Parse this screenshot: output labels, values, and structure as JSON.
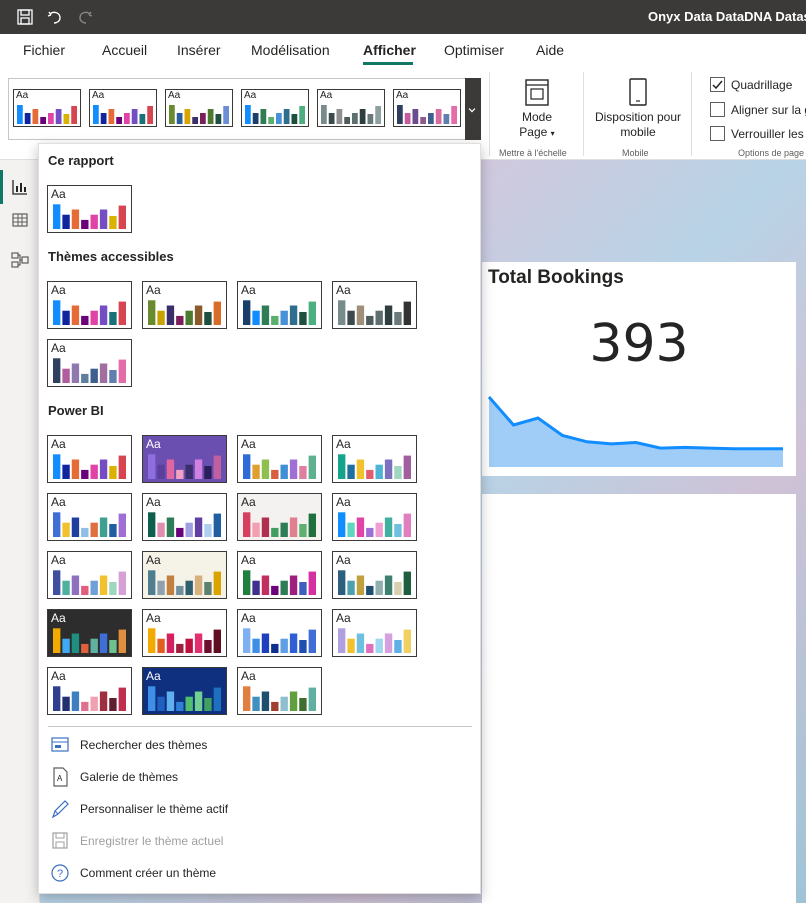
{
  "window": {
    "title": "Onyx Data DataDNA Dataset ("
  },
  "menu": {
    "items": [
      {
        "label": "Fichier",
        "active": false
      },
      {
        "label": "Accueil",
        "active": false
      },
      {
        "label": "Insérer",
        "active": false
      },
      {
        "label": "Modélisation",
        "active": false
      },
      {
        "label": "Afficher",
        "active": true
      },
      {
        "label": "Optimiser",
        "active": false
      },
      {
        "label": "Aide",
        "active": false
      }
    ]
  },
  "ribbon": {
    "mode_page": {
      "line1": "Mode",
      "line2": "Page"
    },
    "mise_echelle_label": "Mettre à l'échelle",
    "mobile_button": {
      "line1": "Disposition pour",
      "line2": "mobile"
    },
    "mobile_label": "Mobile",
    "options_label": "Options de page",
    "checkboxes": [
      {
        "label": "Quadrillage",
        "checked": true
      },
      {
        "label": "Aligner sur la grille",
        "checked": false
      },
      {
        "label": "Verrouiller les objets",
        "checked": false
      }
    ]
  },
  "canvas": {
    "kpi_title": "Total Bookings",
    "kpi_value": "393",
    "sparkline": [
      100,
      60,
      70,
      45,
      36,
      33,
      35,
      27,
      28,
      27,
      26,
      26,
      26
    ]
  },
  "theme_aa": "Aa",
  "gallery": [
    [
      "#118DFF",
      "#12239E",
      "#E66C37",
      "#6B007B",
      "#E044A7",
      "#744EC2",
      "#D9B300",
      "#D64550"
    ],
    [
      "#118DFF",
      "#12239E",
      "#E66C37",
      "#6B007B",
      "#E044A7",
      "#744EC2",
      "#197278",
      "#D64550"
    ],
    [
      "#6A8A2E",
      "#2A5C9E",
      "#D9A300",
      "#3A2F6B",
      "#7A1F5C",
      "#4C7A2E",
      "#1F4F3F",
      "#6B8ED6"
    ],
    [
      "#118DFF",
      "#1A3F6B",
      "#2E7D57",
      "#5AAF6E",
      "#4A90D6",
      "#2E6E8E",
      "#1F4F3F",
      "#4CAF80"
    ],
    [
      "#7A8B8C",
      "#3B4A4C",
      "#8F8F8F",
      "#4C5B5C",
      "#5F6F70",
      "#2F3F40",
      "#6A7A7B",
      "#8FA0A1"
    ],
    [
      "#2F3F5F",
      "#C65C9E",
      "#6B4C8E",
      "#8F5A8E",
      "#3F5F8F",
      "#D96C9E",
      "#5F7FAF",
      "#E46CA8"
    ]
  ],
  "sections": {
    "this_report": "Ce rapport",
    "accessible": "Thèmes accessibles",
    "powerbi": "Power BI"
  },
  "themes": {
    "this_report": [
      {
        "bg": "#ffffff",
        "colors": [
          "#118DFF",
          "#12239E",
          "#E66C37",
          "#6B007B",
          "#E044A7",
          "#744EC2",
          "#D9B300",
          "#D64550"
        ]
      }
    ],
    "accessible": [
      {
        "bg": "#ffffff",
        "colors": [
          "#118DFF",
          "#12239E",
          "#E66C37",
          "#6B007B",
          "#E044A7",
          "#744EC2",
          "#197278",
          "#D64550"
        ]
      },
      {
        "bg": "#ffffff",
        "colors": [
          "#6A8A2E",
          "#C8A200",
          "#3A2F6B",
          "#7A1F5C",
          "#4C7A2E",
          "#8B5A2B",
          "#1F4F3F",
          "#D96C2B"
        ]
      },
      {
        "bg": "#ffffff",
        "colors": [
          "#1A3F6B",
          "#118DFF",
          "#2E7D57",
          "#5AAF6E",
          "#4A90D6",
          "#2E6E8E",
          "#1F4F3F",
          "#4CAF80"
        ]
      },
      {
        "bg": "#ffffff",
        "colors": [
          "#7A8B8C",
          "#3B4A4C",
          "#A0907A",
          "#4C5B5C",
          "#5F6F70",
          "#2F3F40",
          "#6A7A7B",
          "#333333"
        ]
      },
      {
        "bg": "#ffffff",
        "colors": [
          "#2F3F5F",
          "#B05C9E",
          "#8F7AAF",
          "#5F7F9F",
          "#3F5F8F",
          "#9F6F9F",
          "#5F7FAF",
          "#E46CA8"
        ]
      }
    ],
    "powerbi": [
      {
        "bg": "#ffffff",
        "colors": [
          "#118DFF",
          "#12239E",
          "#E66C37",
          "#6B007B",
          "#E044A7",
          "#744EC2",
          "#D9B300",
          "#D64550"
        ]
      },
      {
        "bg": "#6B4FB0",
        "colors": [
          "#8F6FE0",
          "#5A3F9E",
          "#E066A0",
          "#F0A0C0",
          "#3A2F6B",
          "#D080E0",
          "#2A1F5B",
          "#C060A0"
        ]
      },
      {
        "bg": "#ffffff",
        "colors": [
          "#2E6BD6",
          "#E0A030",
          "#8FBF4F",
          "#D65F3F",
          "#3F8FD6",
          "#9F6FD6",
          "#E07FA0",
          "#5FB08F"
        ]
      },
      {
        "bg": "#ffffff",
        "colors": [
          "#14A38B",
          "#1F6F9F",
          "#F2C12E",
          "#E05F6F",
          "#4FB3D6",
          "#7F6FBF",
          "#9FD6C0",
          "#A05F9F"
        ]
      },
      {
        "bg": "#ffffff",
        "colors": [
          "#3F6FD6",
          "#F2C12E",
          "#1F3F9F",
          "#8FBFE6",
          "#E06F3F",
          "#3FA08F",
          "#1F5F9F",
          "#9F6FD6"
        ]
      },
      {
        "bg": "#ffffff",
        "colors": [
          "#0F5F4F",
          "#E08FB0",
          "#2E7D57",
          "#6B007B",
          "#9F9FE0",
          "#5F3F9F",
          "#AFCFEF",
          "#1F5F9F"
        ]
      },
      {
        "bg": "#f3f2f1",
        "colors": [
          "#D63F5F",
          "#F0A0AF",
          "#B02F4F",
          "#3F9F5F",
          "#2E7D57",
          "#E07F8F",
          "#5FAF6F",
          "#1F6F3F"
        ]
      },
      {
        "bg": "#ffffff",
        "colors": [
          "#118DFF",
          "#5FD6C0",
          "#E044A7",
          "#9F6FD6",
          "#F0A0D0",
          "#3FB0A0",
          "#6FC0E0",
          "#E07FBF"
        ]
      },
      {
        "bg": "#ffffff",
        "colors": [
          "#3F4F9F",
          "#4FB0A0",
          "#8F6FBF",
          "#E05F7F",
          "#6FA0D6",
          "#F2C12E",
          "#9FD6C0",
          "#D6A0D6"
        ]
      },
      {
        "bg": "#f5f2e8",
        "colors": [
          "#4F7F8F",
          "#8FA0AF",
          "#C0803F",
          "#6F8F9F",
          "#2F5F6F",
          "#D6B07F",
          "#5F7F6F",
          "#D9A300"
        ]
      },
      {
        "bg": "#ffffff",
        "colors": [
          "#1F7F3F",
          "#3F2F8F",
          "#C02F5F",
          "#6B007B",
          "#2E7D57",
          "#9F1F7F",
          "#3F5FBF",
          "#D62F9F"
        ]
      },
      {
        "bg": "#ffffff",
        "colors": [
          "#2F5F7F",
          "#4FA0AF",
          "#C0A03F",
          "#1F4F6F",
          "#8FB0AF",
          "#3F7F6F",
          "#D6D0B0",
          "#1F5F3F"
        ]
      },
      {
        "bg": "#2d2d2d",
        "colors": [
          "#F2A900",
          "#3FA9F5",
          "#1F8F7F",
          "#E05F3F",
          "#5FB0A0",
          "#3F6FD6",
          "#6FC08F",
          "#E08F3F"
        ]
      },
      {
        "bg": "#ffffff",
        "colors": [
          "#F2A900",
          "#E05F1F",
          "#D61F5F",
          "#9F1F3F",
          "#C0103F",
          "#E0306F",
          "#6F0F2F",
          "#5F0F1F"
        ]
      },
      {
        "bg": "#ffffff",
        "colors": [
          "#7FB0F0",
          "#3F8FE6",
          "#1F3FBF",
          "#0F2F8F",
          "#5F9FE6",
          "#2F5FD6",
          "#1F4FAF",
          "#3F6FD6"
        ]
      },
      {
        "bg": "#ffffff",
        "colors": [
          "#B0A0E0",
          "#F2C12E",
          "#6FC0E0",
          "#E06FBF",
          "#9FD6F0",
          "#D6A0E0",
          "#5FB0E6",
          "#F0D060"
        ]
      },
      {
        "bg": "#ffffff",
        "colors": [
          "#2F3F8F",
          "#1F2F6F",
          "#3F7FC0",
          "#E06F8F",
          "#F0A0B0",
          "#9F2F3F",
          "#5F1F2F",
          "#C02F4F"
        ]
      },
      {
        "bg": "#0F2F7F",
        "colors": [
          "#3F8FE6",
          "#1F5FC0",
          "#5FB0F0",
          "#2F7FD6",
          "#4FBF6F",
          "#6FD08F",
          "#3FA05F",
          "#1F6FBF"
        ]
      },
      {
        "bg": "#ffffff",
        "colors": [
          "#E07F3F",
          "#3F8FC0",
          "#1F4F6F",
          "#9F3F2F",
          "#8FBFCF",
          "#5F9F3F",
          "#3F6F2F",
          "#5FB0A0"
        ]
      }
    ]
  },
  "actions": [
    {
      "label": "Rechercher des thèmes",
      "icon": "browse-themes-icon",
      "disabled": false
    },
    {
      "label": "Galerie de thèmes",
      "icon": "theme-gallery-icon",
      "disabled": false
    },
    {
      "label": "Personnaliser le thème actif",
      "icon": "customize-theme-icon",
      "disabled": false
    },
    {
      "label": "Enregistrer le thème actuel",
      "icon": "save-theme-icon",
      "disabled": true
    },
    {
      "label": "Comment créer un thème",
      "icon": "help-icon",
      "disabled": false
    }
  ]
}
